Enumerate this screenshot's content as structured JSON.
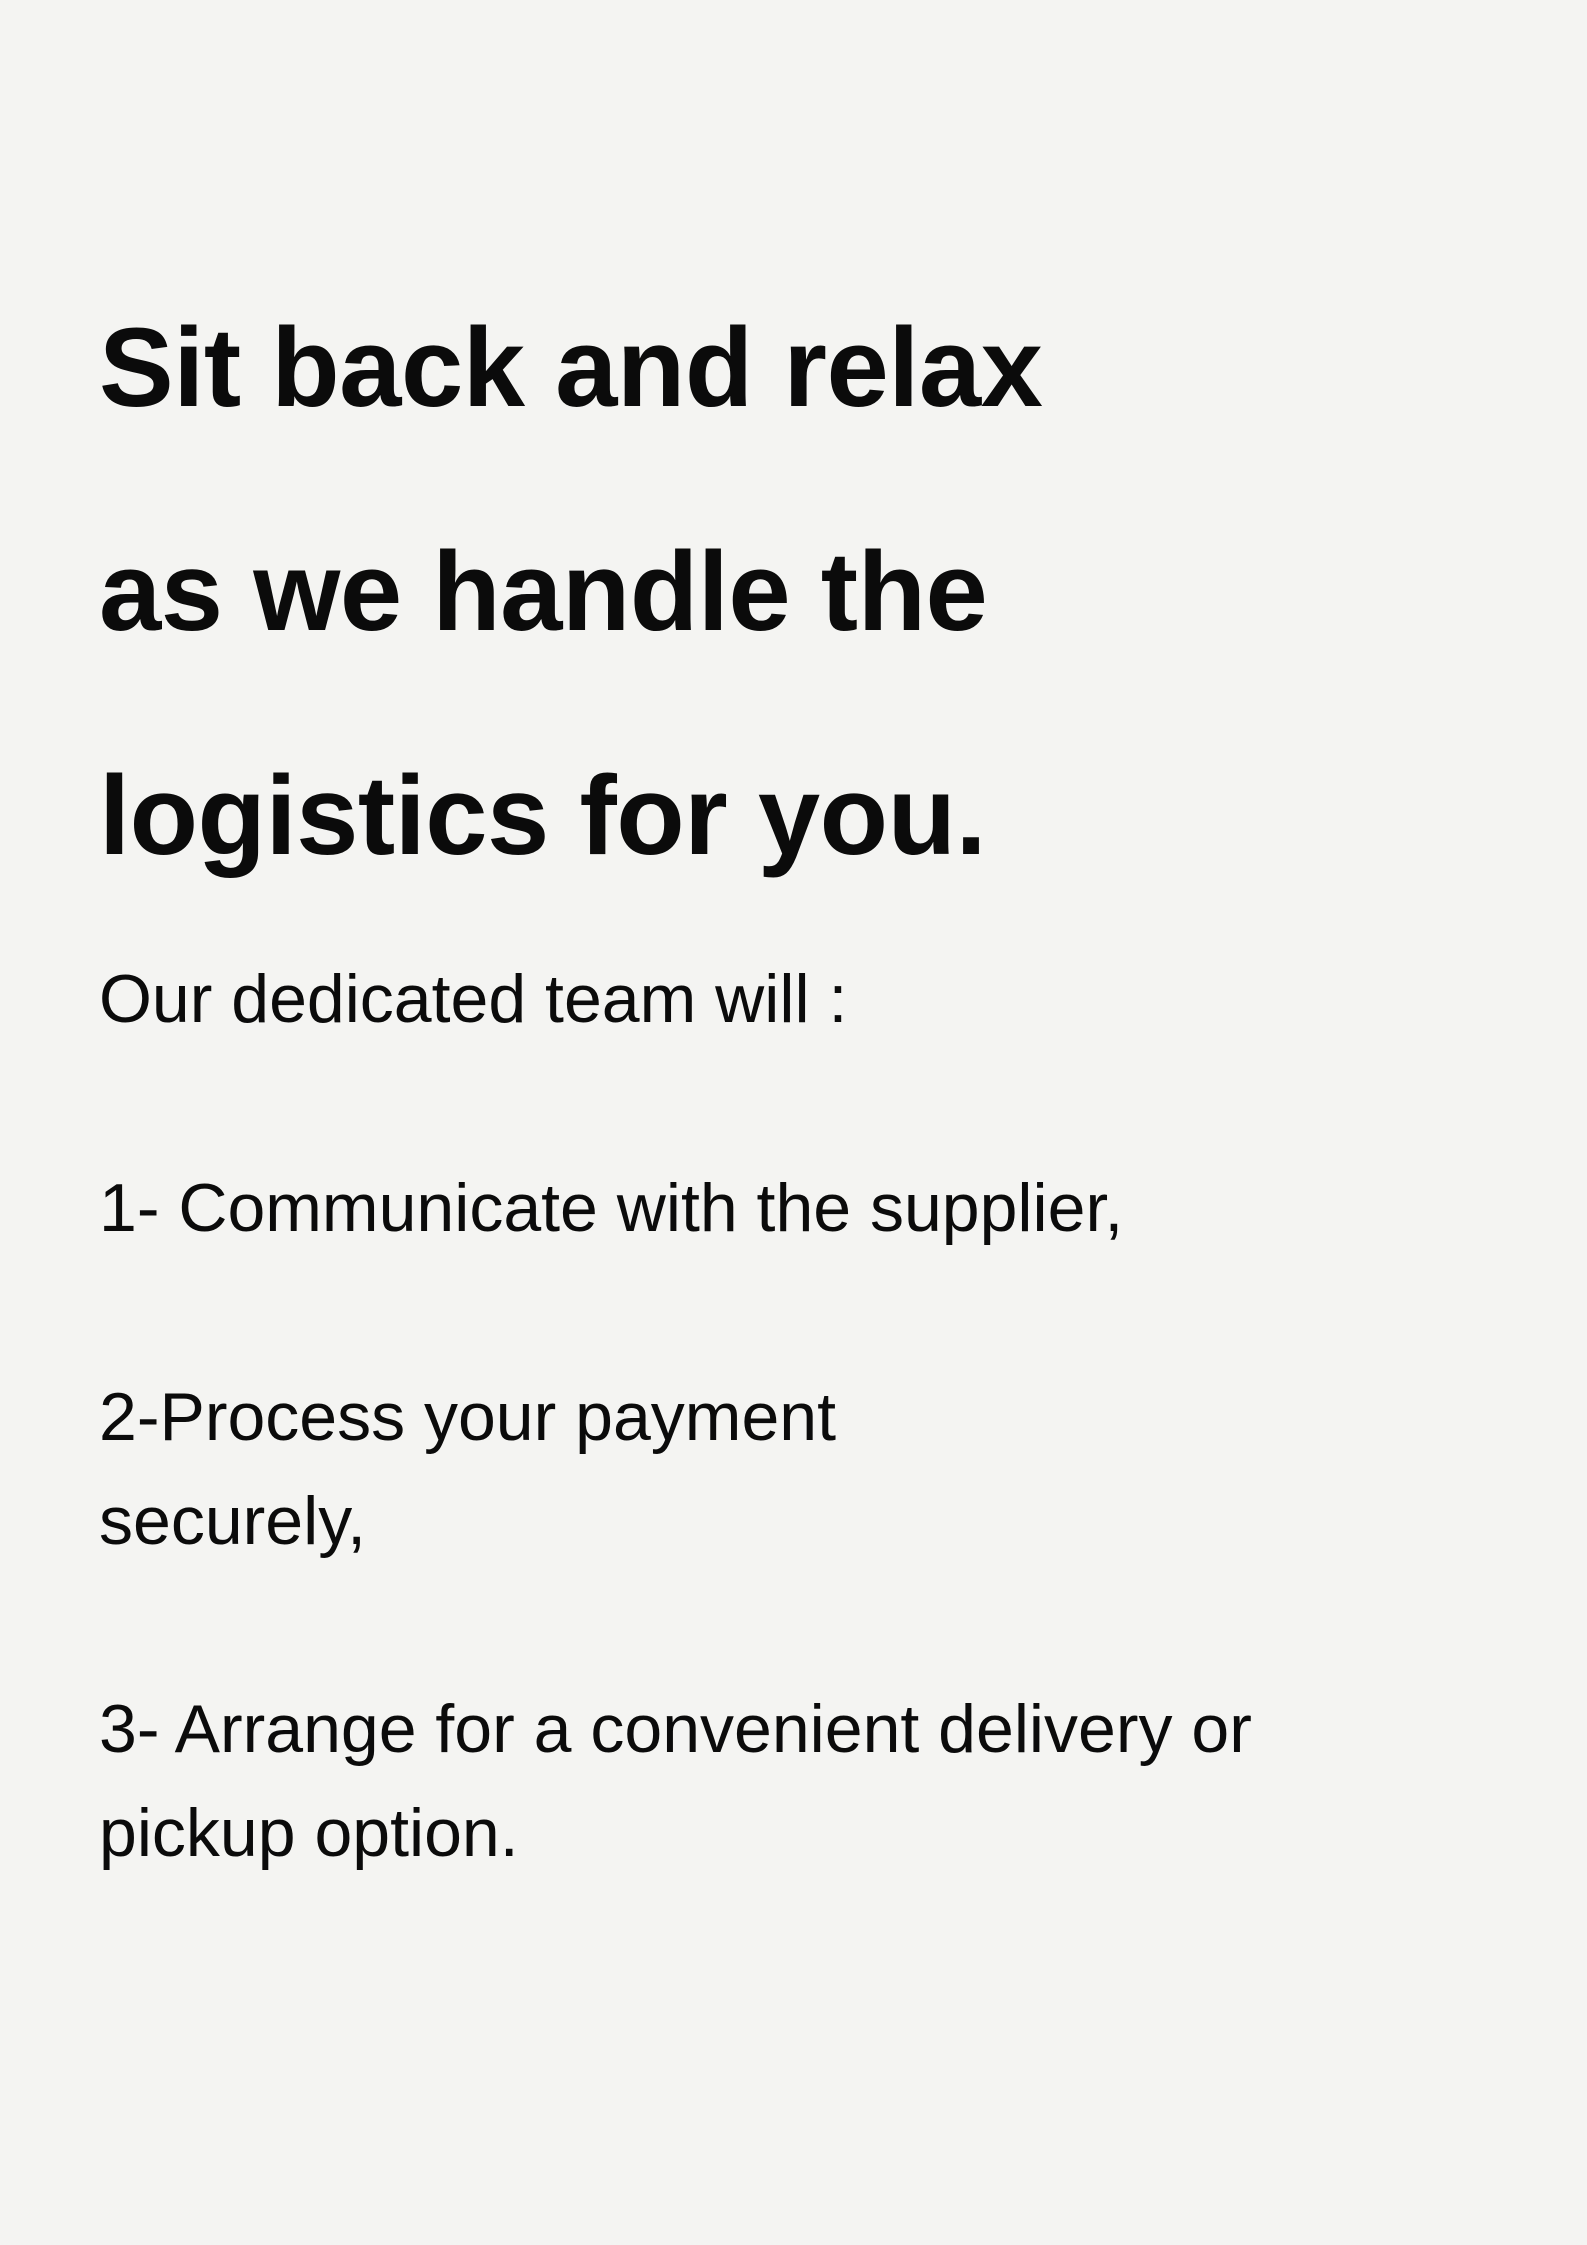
{
  "heading": {
    "lines": [
      "Sit back and relax",
      "as we handle the",
      "logistics for you."
    ]
  },
  "intro": "Our dedicated team will :",
  "steps": [
    {
      "lines": [
        "1- Communicate with the supplier,"
      ]
    },
    {
      "lines": [
        "2-Process your payment",
        "securely,"
      ]
    },
    {
      "lines": [
        "3- Arrange for a convenient delivery or",
        "pickup option."
      ]
    }
  ],
  "colors": {
    "background": "#f4f4f2",
    "text": "#0b0b0b"
  }
}
